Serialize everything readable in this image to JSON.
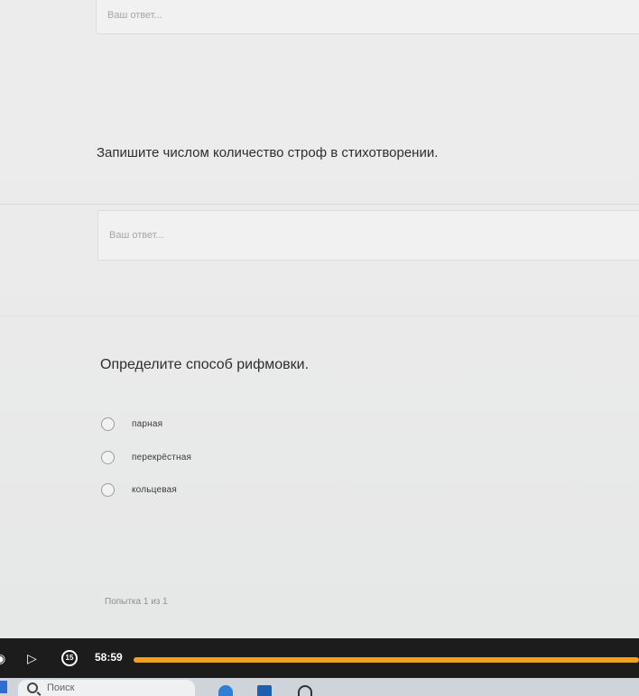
{
  "form": {
    "answer_placeholder_1": "Ваш ответ...",
    "question_1": "Запишите числом количество строф в стихотворении.",
    "answer_placeholder_2": "Ваш ответ...",
    "question_2": "Определите способ рифмовки.",
    "options": [
      {
        "label": "парная",
        "selected": false
      },
      {
        "label": "перекрёстная",
        "selected": false
      },
      {
        "label": "кольцевая",
        "selected": false
      }
    ],
    "attempt_text": "Попытка 1 из 1"
  },
  "player": {
    "time": "58:59",
    "forward_label": "15",
    "progress_fraction": 1.0,
    "accent_color": "#f5a21a"
  },
  "taskbar": {
    "search_placeholder": "Поиск",
    "icons": [
      "windows-start-icon",
      "search-icon",
      "edge-icon",
      "store-icon",
      "app-icon"
    ]
  }
}
